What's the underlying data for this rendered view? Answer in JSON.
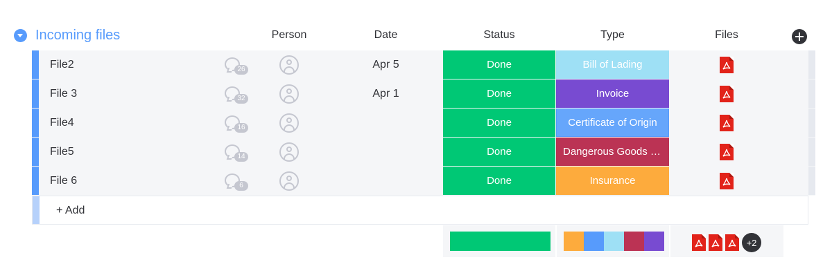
{
  "group": {
    "title": "Incoming files",
    "color": "#579bfc"
  },
  "columns": {
    "person": "Person",
    "date": "Date",
    "status": "Status",
    "type": "Type",
    "files": "Files"
  },
  "rows": [
    {
      "name": "File2",
      "updates": "26",
      "date": "Apr 5",
      "status": "Done",
      "type": "Bill of Lading",
      "type_color": "#9ee0f5"
    },
    {
      "name": "File 3",
      "updates": "32",
      "date": "Apr 1",
      "status": "Done",
      "type": "Invoice",
      "type_color": "#784bd1"
    },
    {
      "name": "File4",
      "updates": "16",
      "date": "",
      "status": "Done",
      "type": "Certificate of Origin",
      "type_color": "#66a6fb"
    },
    {
      "name": "File5",
      "updates": "14",
      "date": "",
      "status": "Done",
      "type": "Dangerous Goods Ce...",
      "type_color": "#bb3354"
    },
    {
      "name": "File 6",
      "updates": "6",
      "date": "",
      "status": "Done",
      "type": "Insurance",
      "type_color": "#fdab3d"
    }
  ],
  "add_row": {
    "label": "+ Add"
  },
  "summary": {
    "status_color": "#00c875",
    "type_colors": [
      "#fdab3d",
      "#579bfc",
      "#9ee0f5",
      "#bb3354",
      "#784bd1"
    ],
    "files_more": "+2"
  },
  "colors": {
    "done": "#00c875",
    "pdf": "#e2231a"
  },
  "icons": [
    "collapse-arrow-icon",
    "add-column-icon",
    "chat-bubble-icon",
    "person-avatar-icon",
    "pdf-file-icon"
  ]
}
